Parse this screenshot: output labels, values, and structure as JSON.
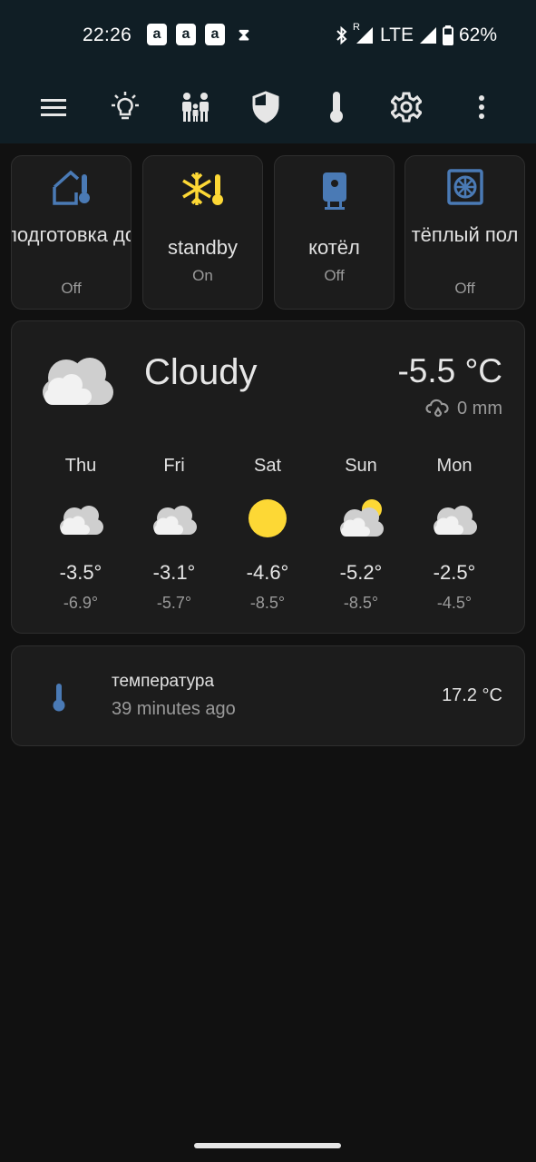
{
  "status_bar": {
    "time": "22:26",
    "notifications": [
      "a",
      "a",
      "a",
      "⧗"
    ],
    "network": "LTE",
    "roaming": "R",
    "battery": "62%"
  },
  "toolbar": {
    "icons": [
      "menu-icon",
      "lightbulb-icon",
      "family-icon",
      "shield-icon",
      "thermometer-icon",
      "gear-icon",
      "more-vert-icon"
    ],
    "active": "thermometer-icon"
  },
  "tiles": [
    {
      "name": "подготовка дома",
      "state": "Off",
      "icon": "home-thermometer-icon",
      "color": "#4a7ab5"
    },
    {
      "name": "standby",
      "state": "On",
      "icon": "snowflake-thermometer-icon",
      "color": "#fdd835"
    },
    {
      "name": "котёл",
      "state": "Off",
      "icon": "water-boiler-icon",
      "color": "#4a7ab5"
    },
    {
      "name": "тёплый пол",
      "state": "Off",
      "icon": "heating-coil-icon",
      "color": "#4a7ab5"
    }
  ],
  "weather": {
    "condition": "Cloudy",
    "temperature": "-5.5 °C",
    "precipitation": "0 mm",
    "forecast": [
      {
        "day": "Thu",
        "icon": "cloudy-icon",
        "high": "-3.5°",
        "low": "-6.9°"
      },
      {
        "day": "Fri",
        "icon": "cloudy-icon",
        "high": "-3.1°",
        "low": "-5.7°"
      },
      {
        "day": "Sat",
        "icon": "sunny-icon",
        "high": "-4.6°",
        "low": "-8.5°"
      },
      {
        "day": "Sun",
        "icon": "partly-cloudy-icon",
        "high": "-5.2°",
        "low": "-8.5°"
      },
      {
        "day": "Mon",
        "icon": "cloudy-icon",
        "high": "-2.5°",
        "low": "-4.5°"
      }
    ]
  },
  "sensor": {
    "name": "температура",
    "last_changed": "39 minutes ago",
    "value": "17.2 °C",
    "icon": "thermometer-icon",
    "color": "#4a7ab5"
  }
}
